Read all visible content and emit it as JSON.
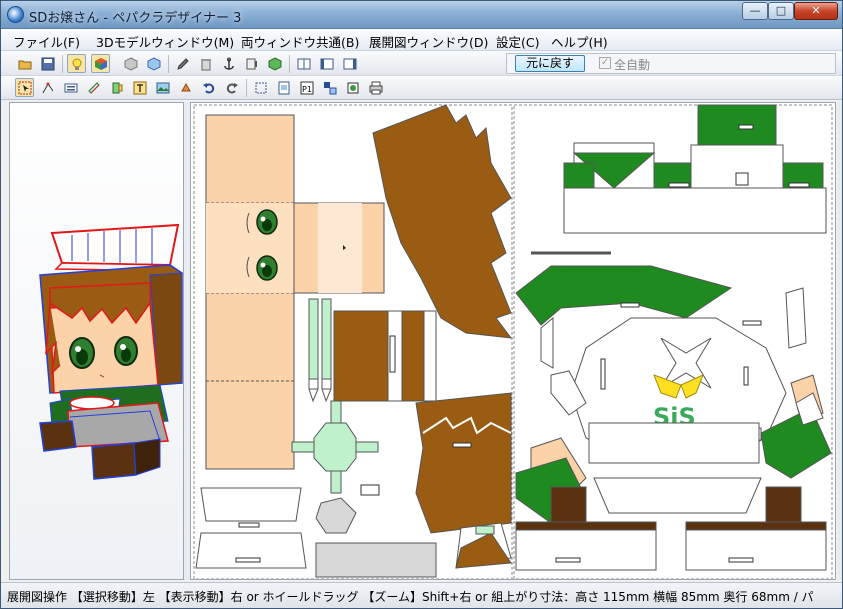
{
  "window": {
    "title": "SDお嬢さん - ペパクラデザイナー 3",
    "minimize": "—",
    "maximize": "□",
    "close": "✕"
  },
  "menu": [
    {
      "label": "ファイル(F)"
    },
    {
      "label": "3Dモデルウィンドウ(M)"
    },
    {
      "label": "両ウィンドウ共通(B)"
    },
    {
      "label": "展開図ウィンドウ(D)"
    },
    {
      "label": "設定(C)"
    },
    {
      "label": "ヘルプ(H)"
    }
  ],
  "toolbar": {
    "reset_label": "元に戻す",
    "auto_label": "全自動",
    "auto_checked": "✓"
  },
  "icons": {
    "row1": [
      "folder-open-icon",
      "save-icon",
      "lightbulb-icon",
      "color-cube-icon",
      "cube-gray-icon",
      "cube-blue-icon",
      "pencil-icon",
      "trash-can-icon",
      "anchor-icon",
      "edge-icon",
      "cube-green-icon",
      "window-split-icon",
      "window-left-icon",
      "window-right-icon"
    ],
    "row2": [
      "select-arrow-icon",
      "move-node-icon",
      "keyboard-icon",
      "ruler-icon",
      "flap-icon",
      "text-icon",
      "image-icon",
      "rotate-part-icon",
      "undo-icon",
      "redo-icon",
      "fit-icon",
      "page-icon",
      "page-number-icon",
      "layout-icon",
      "export-icon",
      "print-icon"
    ]
  },
  "status": {
    "text": "展開図操作 【選択移動】左 【表示移動】右 or ホイールドラッグ 【ズーム】Shift+右 or 組上がり寸法：高さ 115mm 横幅 85mm 奥行 68mm / パ"
  },
  "colors": {
    "skin": "#fcd3a8",
    "hair": "#9a5c12",
    "green": "#1f8a1f",
    "brown": "#5a3210",
    "light_green": "#bff2cc",
    "edge_red": "#e01818",
    "edge_blue": "#2040e0"
  }
}
